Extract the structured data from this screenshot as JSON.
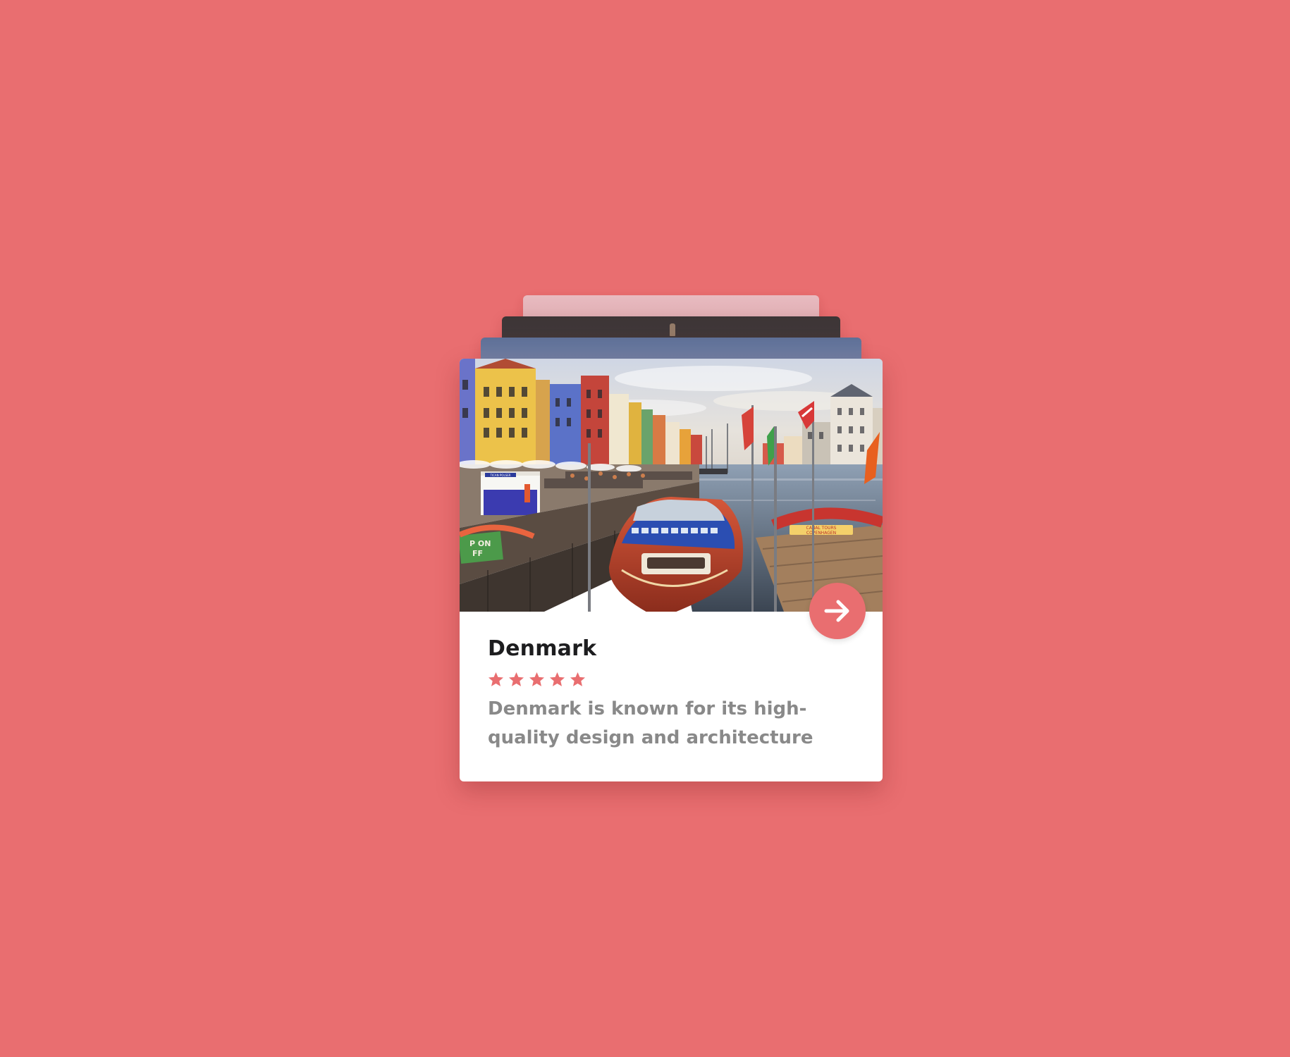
{
  "colors": {
    "background": "#e96e70",
    "accent": "#e96e70",
    "card": "#ffffff",
    "title": "#1d1d1f",
    "description": "#898989"
  },
  "card": {
    "title": "Denmark",
    "rating": 5,
    "rating_max": 5,
    "description": "Denmark is known for its high-quality design and architecture",
    "next_button_icon": "arrow-right-icon"
  },
  "image_labels": {
    "kiosk_sign": "TICAN POLSER",
    "tour_sign_line1": "CANAL TOURS",
    "tour_sign_line2": "COPENHAGEN",
    "green_sign_line1": "P ON",
    "green_sign_line2": "FF"
  }
}
